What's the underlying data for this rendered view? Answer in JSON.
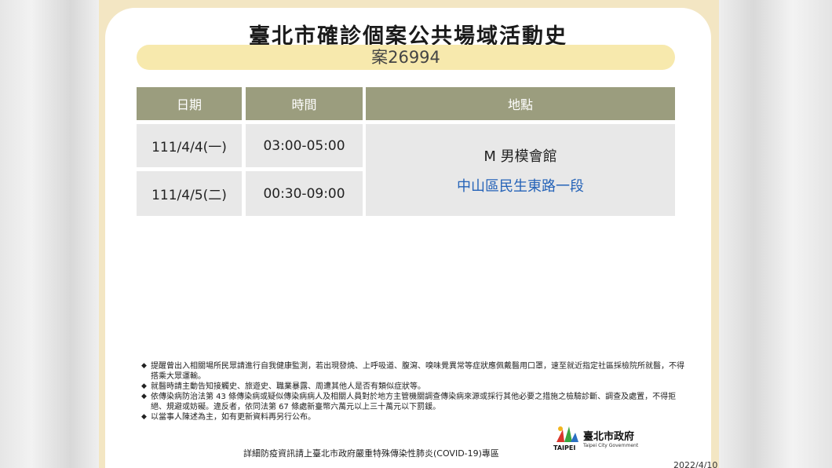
{
  "title": "臺北市確診個案公共場域活動史",
  "case_label": "案26994",
  "table": {
    "headers": [
      "日期",
      "時間",
      "地點"
    ],
    "rows": [
      {
        "date": "111/4/4(一)",
        "time": "03:00-05:00"
      },
      {
        "date": "111/4/5(二)",
        "time": "00:30-09:00"
      }
    ],
    "place_name": "M 男模會館",
    "place_address": "中山區民生東路一段"
  },
  "notes": [
    "提醒曾出入相關場所民眾請進行自我健康監測，若出現發燒、上呼吸道、腹瀉、嗅味覺異常等症狀應佩戴醫用口罩，速至就近指定社區採檢院所就醫，不得搭乘大眾運輸。",
    "就醫時請主動告知接觸史、旅遊史、職業暴露、周遭其他人是否有類似症狀等。",
    "依傳染病防治法第 43 條傳染病或疑似傳染病病人及相關人員對於地方主管機關調查傳染病來源或採行其他必要之措施之檢驗診斷、調查及處置，不得拒絕、規避或妨礙。違反者，依同法第 67 條處新臺幣六萬元以上三十萬元以下罰鍰。",
    "以當事人陳述為主，如有更新資料再另行公布。"
  ],
  "footer_text": "詳細防疫資訊請上臺北市政府嚴重特殊傳染性肺炎(COVID-19)專區",
  "logo": {
    "mark_text": "TAIPEI",
    "name_cn": "臺北市政府",
    "name_en": "Taipei City Government",
    "colors": {
      "red": "#d9362b",
      "green": "#3aa53f",
      "blue": "#2a6fc1",
      "yellow": "#f2b51d"
    }
  },
  "date": "2022/4/10",
  "colors": {
    "frame": "#f3e6c3",
    "case_pill": "#f7e9ad",
    "header_bg": "#9b9d7e",
    "cell_bg": "#e8e8e8",
    "address": "#2563b8"
  }
}
